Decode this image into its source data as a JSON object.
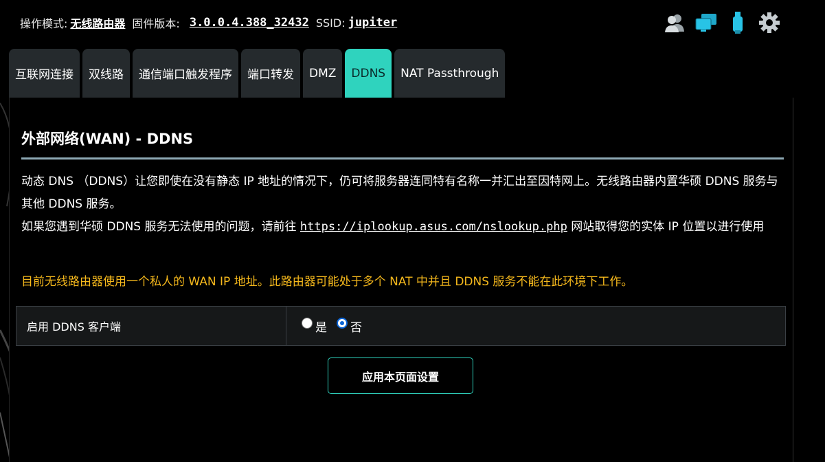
{
  "topbar": {
    "mode_label": "操作模式:",
    "mode_value": "无线路由器",
    "firmware_label": "固件版本:",
    "firmware_value": "3.0.0.4.388_32432",
    "ssid_label": "SSID:",
    "ssid_value": "jupiter",
    "icons": [
      "users-icon",
      "network-clients-icon",
      "usb-icon",
      "settings-gear-icon"
    ]
  },
  "tabs": [
    {
      "label": "互联网连接",
      "active": false
    },
    {
      "label": "双线路",
      "active": false
    },
    {
      "label": "通信端口触发程序",
      "active": false
    },
    {
      "label": "端口转发",
      "active": false
    },
    {
      "label": "DMZ",
      "active": false
    },
    {
      "label": "DDNS",
      "active": true
    },
    {
      "label": "NAT Passthrough",
      "active": false
    }
  ],
  "panel": {
    "title": "外部网络(WAN) - DDNS",
    "desc_line1": "动态 DNS （DDNS）让您即使在没有静态 IP 地址的情况下，仍可将服务器连同特有名称一并汇出至因特网上。无线路由器内置华硕 DDNS 服务与其他 DDNS 服务。",
    "desc_line2_prefix": "如果您遇到华硕 DDNS 服务无法使用的问题，请前往 ",
    "desc_link": "https://iplookup.asus.com/nslookup.php",
    "desc_line2_suffix": " 网站取得您的实体 IP 位置以进行使用",
    "warning": "目前无线路由器使用一个私人的 WAN IP 地址。此路由器可能处于多个 NAT 中并且 DDNS 服务不能在此环境下工作。",
    "setting_label": "启用 DDNS 客户端",
    "option_yes": "是",
    "option_no": "否",
    "selected": "否",
    "apply_button": "应用本页面设置"
  },
  "colors": {
    "accent": "#2fd3be",
    "warning": "#f5b81c",
    "tab_bg": "#252a2d",
    "divider": "#8ea9b5"
  }
}
